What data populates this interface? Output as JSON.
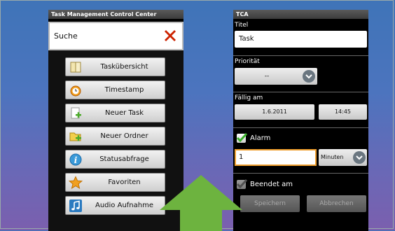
{
  "left_app": {
    "title": "Task Management Control Center",
    "search": {
      "value": "Suche"
    },
    "menu": [
      {
        "label": "Taskübersicht",
        "icon": "book-icon"
      },
      {
        "label": "Timestamp",
        "icon": "alarm-clock-icon"
      },
      {
        "label": "Neuer Task",
        "icon": "new-document-icon"
      },
      {
        "label": "Neuer Ordner",
        "icon": "new-folder-icon"
      },
      {
        "label": "Statusabfrage",
        "icon": "info-icon"
      },
      {
        "label": "Favoriten",
        "icon": "star-icon"
      },
      {
        "label": "Audio Aufnahme",
        "icon": "music-note-icon"
      }
    ]
  },
  "right_app": {
    "title": "TCA",
    "titel_label": "Titel",
    "titel_value": "Task",
    "prioritaet_label": "Priorität",
    "prioritaet_value": "--",
    "faellig_label": "Fällig am",
    "date_value": "1.6.2011",
    "time_value": "14:45",
    "alarm_label": "Alarm",
    "alarm_checked": true,
    "alarm_amount": "1",
    "alarm_unit": "Minuten",
    "beendet_label": "Beendet am",
    "beendet_checked": true,
    "save_label": "Speichern",
    "cancel_label": "Abbrechen"
  },
  "colors": {
    "arrow": "#6db33f",
    "clear_x": "#cc2200",
    "focus_border": "#f0a030"
  }
}
